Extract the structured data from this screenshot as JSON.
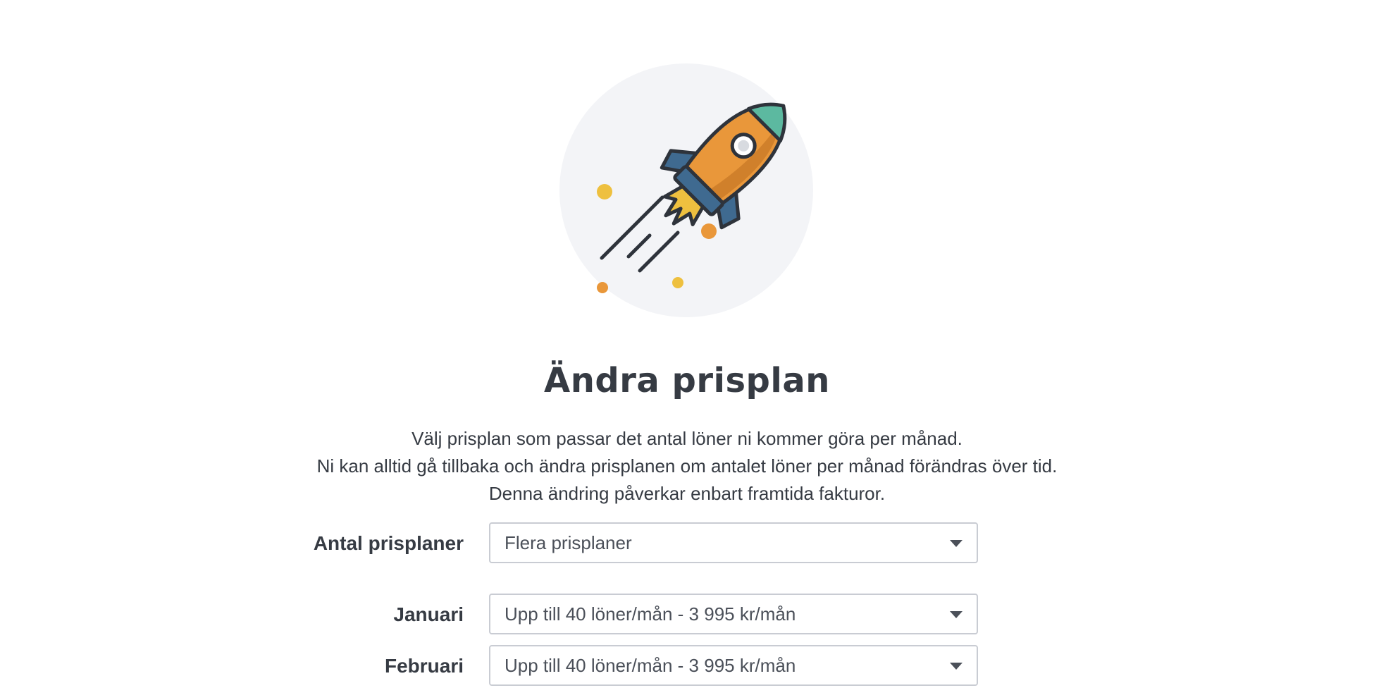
{
  "header": {
    "illustration": "rocket-illustration",
    "colors": {
      "circle_bg": "#f3f4f7",
      "rocket_body": "#e9973a",
      "rocket_nose": "#5cb9a0",
      "rocket_fins": "#3f6a90",
      "flame": "#eec03f",
      "outline": "#2e333b"
    }
  },
  "title": "Ändra prisplan",
  "intro": {
    "line1": "Välj prisplan som passar det antal löner ni kommer göra per månad.",
    "line2": "Ni kan alltid gå tillbaka och ändra prisplanen om antalet löner per månad förändras över tid.",
    "line3": "Denna ändring påverkar enbart framtida fakturor."
  },
  "form": {
    "plan_count": {
      "label": "Antal prisplaner",
      "value": "Flera prisplaner"
    },
    "months": [
      {
        "label": "Januari",
        "value": "Upp till 40 löner/mån - 3 995 kr/mån"
      },
      {
        "label": "Februari",
        "value": "Upp till 40 löner/mån - 3 995 kr/mån"
      }
    ]
  }
}
